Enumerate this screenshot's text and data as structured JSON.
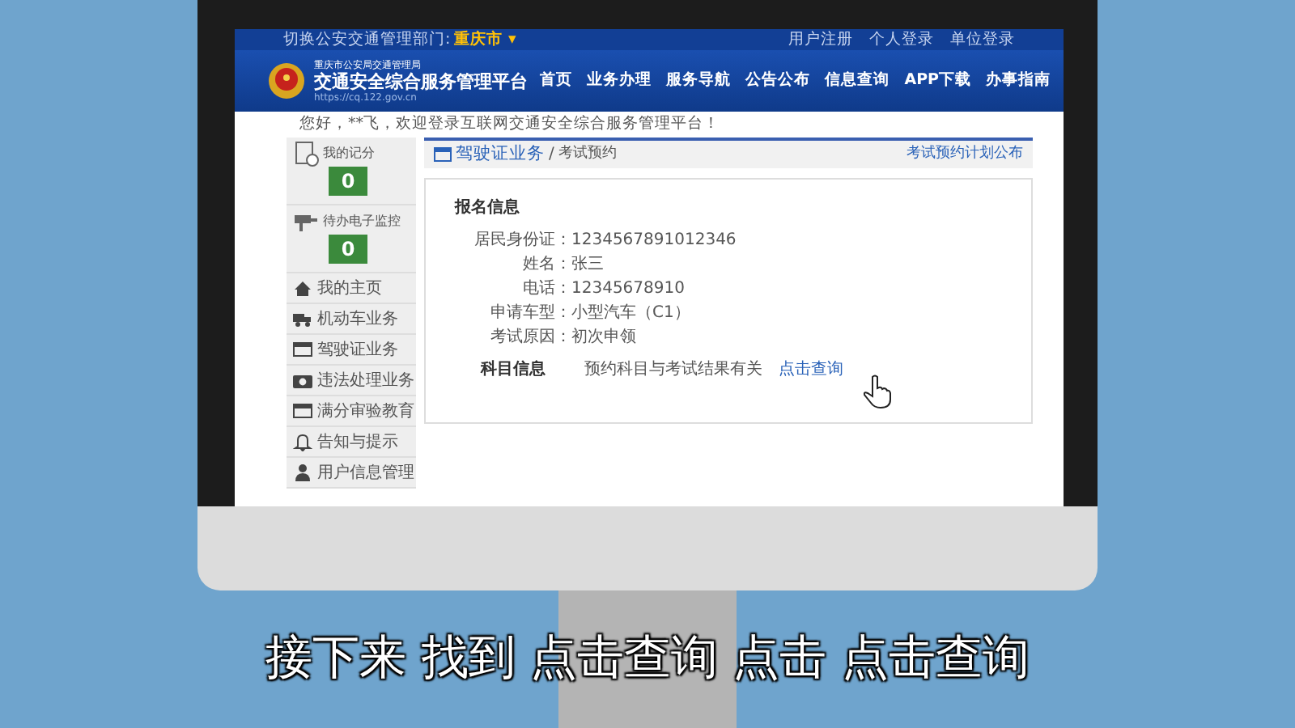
{
  "top_bar": {
    "department_label": "切换公安交通管理部门:",
    "city": "重庆市",
    "city_caret": "▾",
    "links": [
      "用户注册",
      "个人登录",
      "单位登录"
    ]
  },
  "header": {
    "subtitle": "重庆市公安局交通管理局",
    "title": "交通安全综合服务管理平台",
    "url": "https://cq.122.gov.cn",
    "nav": [
      "首页",
      "业务办理",
      "服务导航",
      "公告公布",
      "信息查询",
      "APP下载",
      "办事指南"
    ]
  },
  "welcome": "您好，**飞，欢迎登录互联网交通安全综合服务管理平台！",
  "sidebar": {
    "stats": [
      {
        "label": "我的记分",
        "value": "0"
      },
      {
        "label": "待办电子监控",
        "value": "0"
      }
    ],
    "items": [
      "我的主页",
      "机动车业务",
      "驾驶证业务",
      "违法处理业务",
      "满分审验教育",
      "告知与提示",
      "用户信息管理"
    ]
  },
  "breadcrumb": {
    "section": "驾驶证业务",
    "separator": "/",
    "page": "考试预约",
    "link": "考试预约计划公布"
  },
  "registration": {
    "title": "报名信息",
    "fields": [
      {
        "label": "居民身份证：",
        "value": "1234567891012346"
      },
      {
        "label": "姓名：",
        "value": "张三"
      },
      {
        "label": "电话：",
        "value": "12345678910"
      },
      {
        "label": "申请车型：",
        "value": "小型汽车（C1）"
      },
      {
        "label": "考试原因：",
        "value": "初次申领"
      }
    ]
  },
  "subjects": {
    "title": "科目信息",
    "text": "预约科目与考试结果有关",
    "link": "点击查询"
  },
  "caption": "接下来 找到 点击查询 点击 点击查询"
}
